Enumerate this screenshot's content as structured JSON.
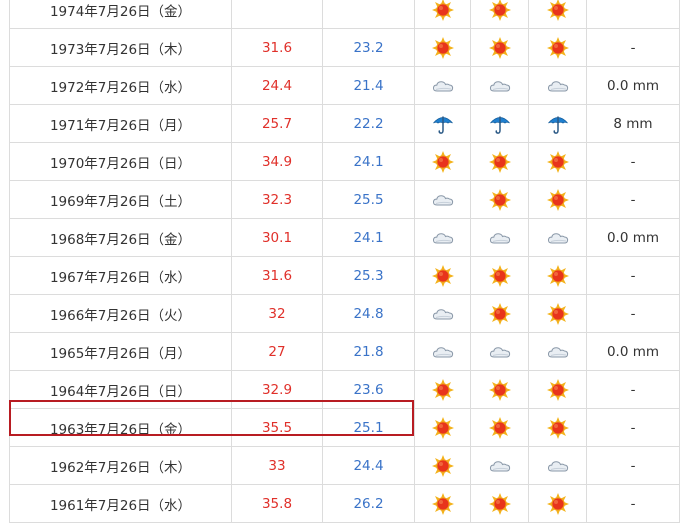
{
  "colors": {
    "max_temp": "#e0302a",
    "min_temp": "#3a73c8",
    "highlight_border": "#b81c22",
    "grid": "#dcdcdc"
  },
  "icon_names": {
    "sun": "sunny-icon",
    "cloud": "cloudy-icon",
    "umbrella": "rain-umbrella-icon"
  },
  "highlighted_row_index": 11,
  "rows": [
    {
      "date": "1974年7月26日（金）",
      "max": "",
      "min": "",
      "w": [
        "sun",
        "sun",
        "sun"
      ],
      "rain": ""
    },
    {
      "date": "1973年7月26日（木）",
      "max": "31.6",
      "min": "23.2",
      "w": [
        "sun",
        "sun",
        "sun"
      ],
      "rain": "-"
    },
    {
      "date": "1972年7月26日（水）",
      "max": "24.4",
      "min": "21.4",
      "w": [
        "cloud",
        "cloud",
        "cloud"
      ],
      "rain": "0.0 mm"
    },
    {
      "date": "1971年7月26日（月）",
      "max": "25.7",
      "min": "22.2",
      "w": [
        "umbrella",
        "umbrella",
        "umbrella"
      ],
      "rain": "8 mm"
    },
    {
      "date": "1970年7月26日（日）",
      "max": "34.9",
      "min": "24.1",
      "w": [
        "sun",
        "sun",
        "sun"
      ],
      "rain": "-"
    },
    {
      "date": "1969年7月26日（土）",
      "max": "32.3",
      "min": "25.5",
      "w": [
        "cloud",
        "sun",
        "sun"
      ],
      "rain": "-"
    },
    {
      "date": "1968年7月26日（金）",
      "max": "30.1",
      "min": "24.1",
      "w": [
        "cloud",
        "cloud",
        "cloud"
      ],
      "rain": "0.0 mm"
    },
    {
      "date": "1967年7月26日（水）",
      "max": "31.6",
      "min": "25.3",
      "w": [
        "sun",
        "sun",
        "sun"
      ],
      "rain": "-"
    },
    {
      "date": "1966年7月26日（火）",
      "max": "32",
      "min": "24.8",
      "w": [
        "cloud",
        "sun",
        "sun"
      ],
      "rain": "-"
    },
    {
      "date": "1965年7月26日（月）",
      "max": "27",
      "min": "21.8",
      "w": [
        "cloud",
        "cloud",
        "cloud"
      ],
      "rain": "0.0 mm"
    },
    {
      "date": "1964年7月26日（日）",
      "max": "32.9",
      "min": "23.6",
      "w": [
        "sun",
        "sun",
        "sun"
      ],
      "rain": "-"
    },
    {
      "date": "1963年7月26日（金）",
      "max": "35.5",
      "min": "25.1",
      "w": [
        "sun",
        "sun",
        "sun"
      ],
      "rain": "-"
    },
    {
      "date": "1962年7月26日（木）",
      "max": "33",
      "min": "24.4",
      "w": [
        "sun",
        "cloud",
        "cloud"
      ],
      "rain": "-"
    },
    {
      "date": "1961年7月26日（水）",
      "max": "35.8",
      "min": "26.2",
      "w": [
        "sun",
        "sun",
        "sun"
      ],
      "rain": "-"
    }
  ]
}
